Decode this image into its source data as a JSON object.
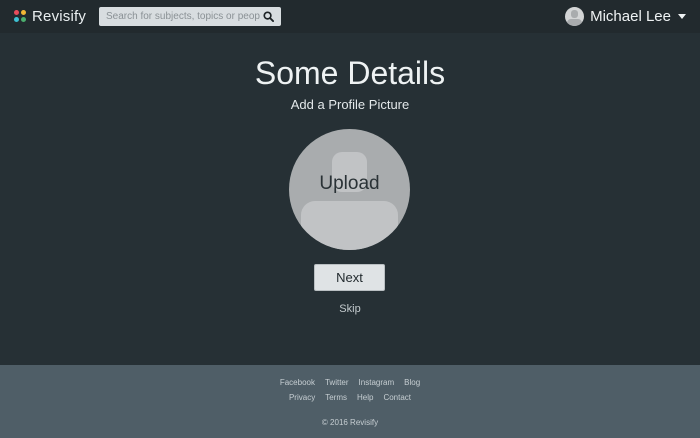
{
  "navbar": {
    "brand": "Revisify",
    "logo_colors": [
      "#e84c5b",
      "#f2b635",
      "#3ec1d3",
      "#4caf6e"
    ],
    "search_placeholder": "Search for subjects, topics or people",
    "search_icon": "search-icon",
    "user_name": "Michael Lee",
    "user_caret_icon": "caret-down-icon"
  },
  "main": {
    "title": "Some Details",
    "subtitle": "Add a Profile Picture",
    "upload_label": "Upload",
    "next_label": "Next",
    "skip_label": "Skip"
  },
  "footer": {
    "row1": [
      "Facebook",
      "Twitter",
      "Instagram",
      "Blog"
    ],
    "row2": [
      "Privacy",
      "Terms",
      "Help",
      "Contact"
    ],
    "copyright": "© 2016 Revisify"
  }
}
